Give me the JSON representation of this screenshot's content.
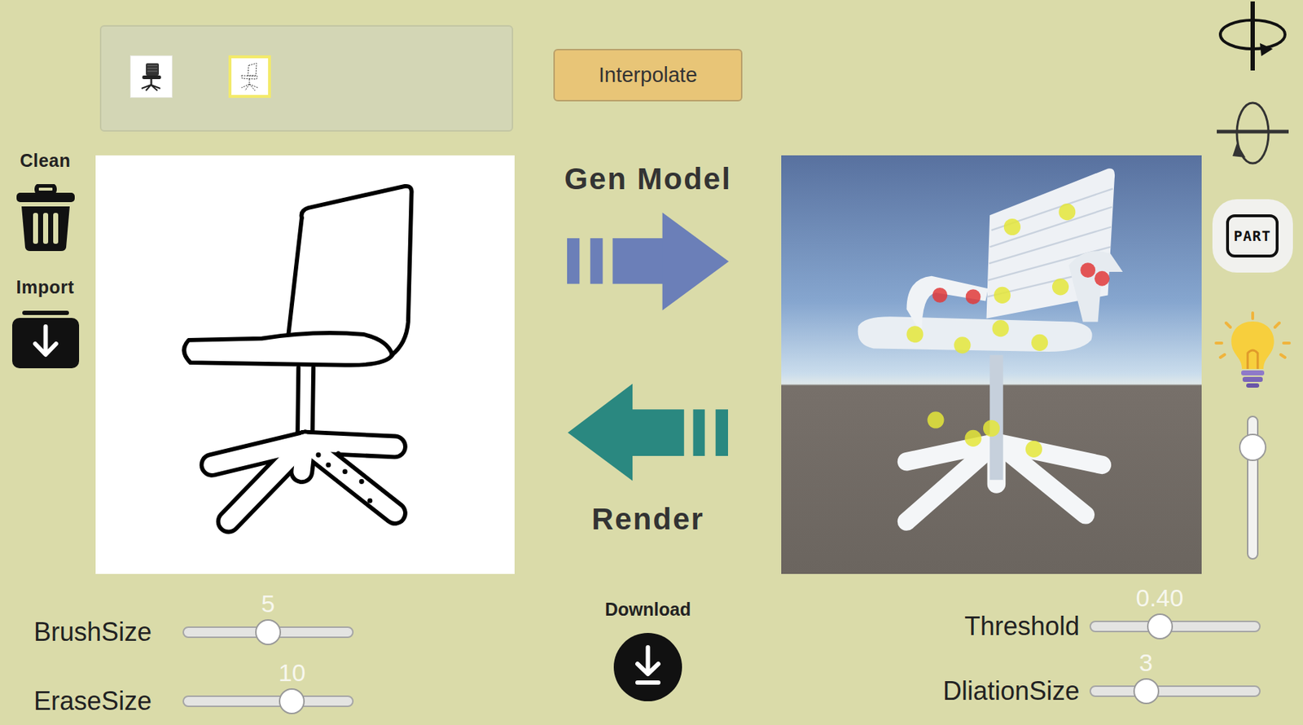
{
  "thumbnails": [
    {
      "kind": "photo",
      "selected": false
    },
    {
      "kind": "sketch",
      "selected": true
    }
  ],
  "interpolate_button": {
    "label": "Interpolate"
  },
  "left_tools": [
    {
      "kind": "clean",
      "label": "Clean"
    },
    {
      "kind": "import",
      "label": "Import"
    }
  ],
  "pipeline": {
    "generate": "Gen Model",
    "render": "Render"
  },
  "download": {
    "label": "Download"
  },
  "brush_sliders": [
    {
      "label": "BrushSize",
      "value": "5",
      "level": 0.5
    },
    {
      "label": "EraseSize",
      "value": "10",
      "level": 0.64
    }
  ],
  "mesh_sliders": [
    {
      "label": "Threshold",
      "value": "0.40",
      "level": 0.41
    },
    {
      "label": "DliationSize",
      "value": "3",
      "level": 0.33
    }
  ],
  "right_tools": {
    "part_label": "PART",
    "light_level": 0.78
  }
}
